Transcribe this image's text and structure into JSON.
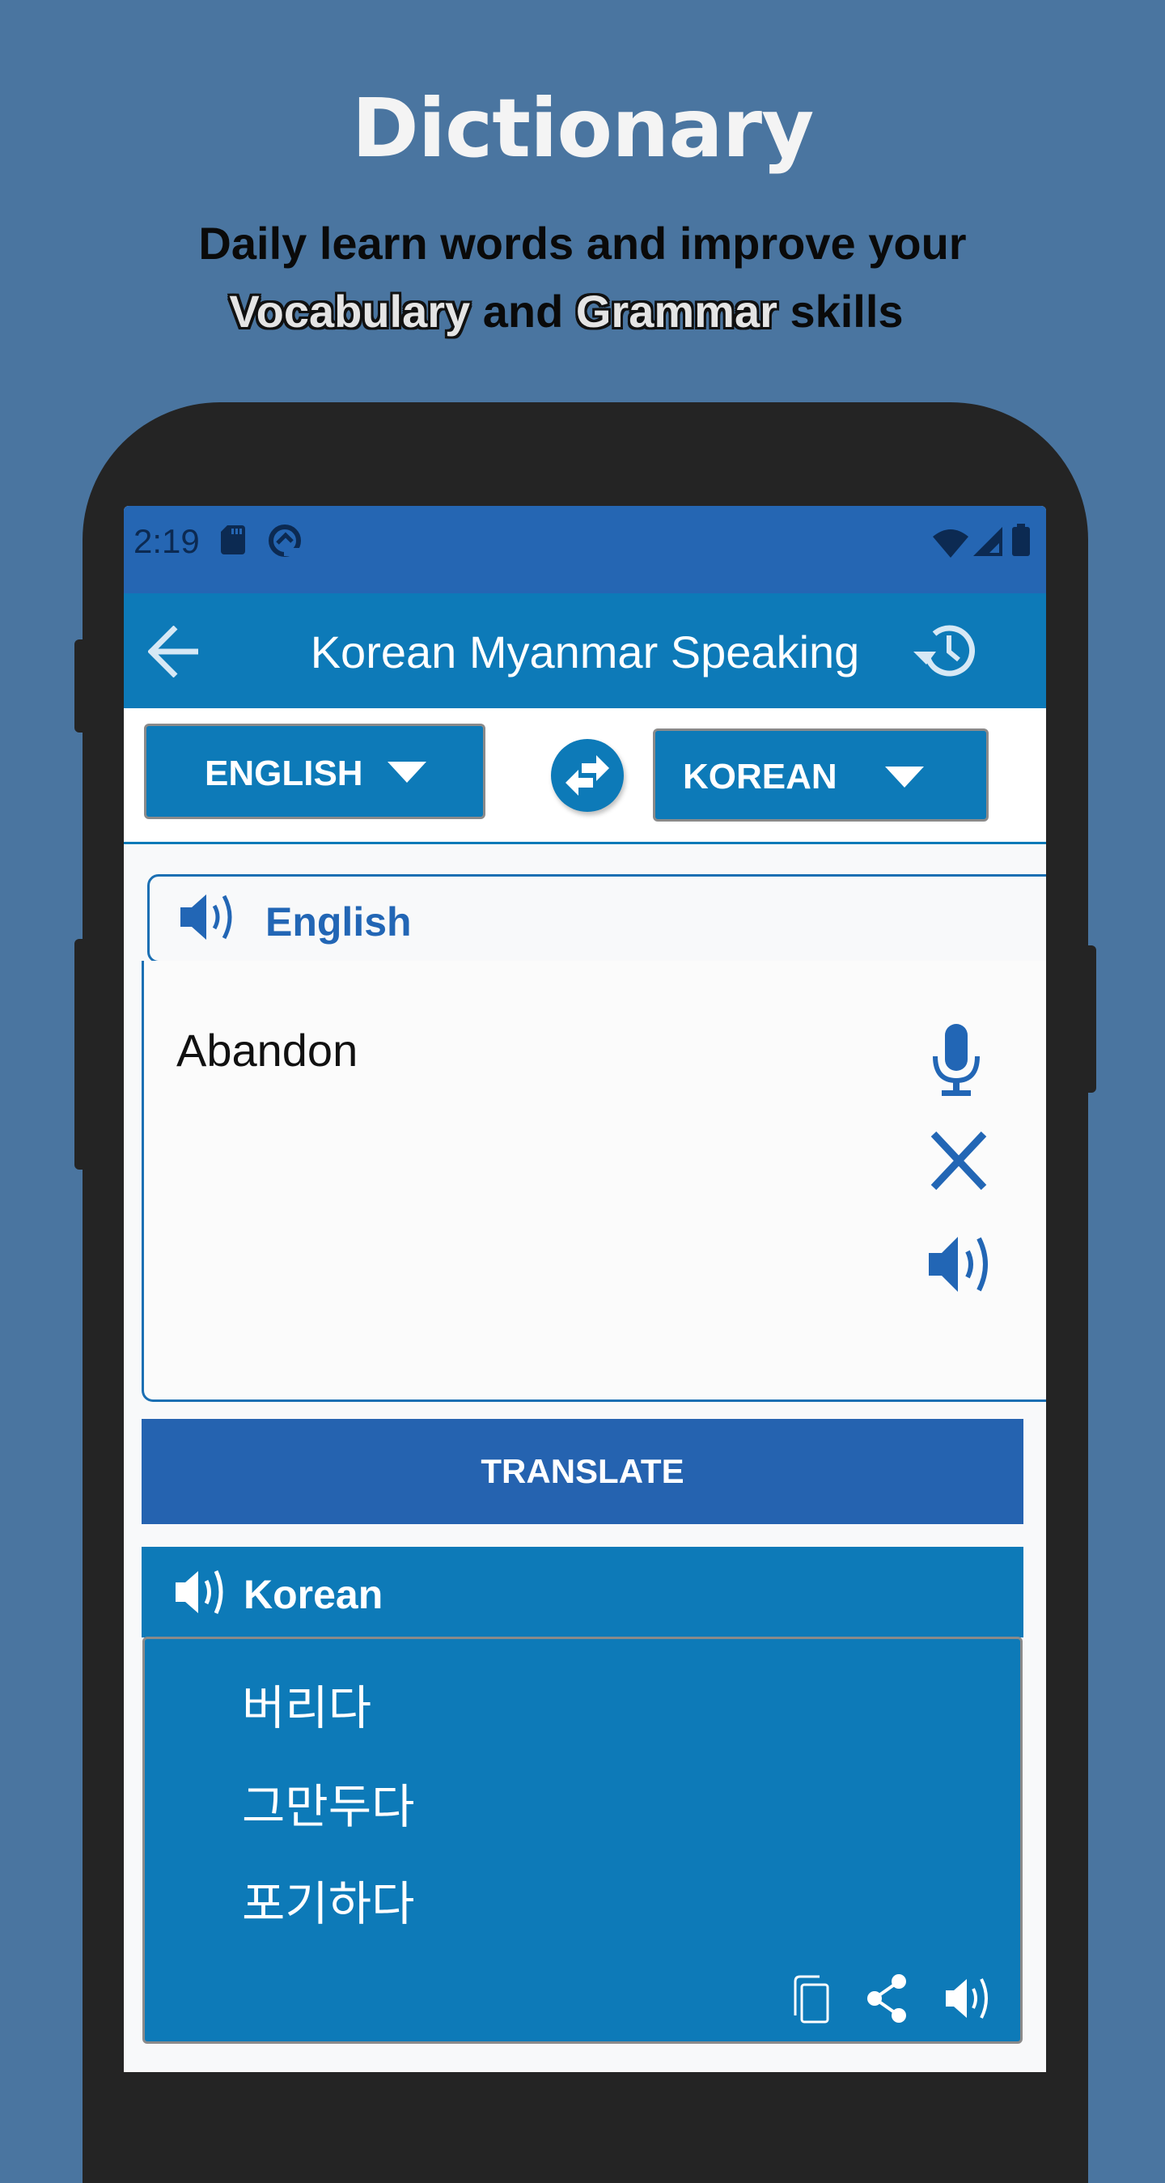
{
  "promo": {
    "title": "Dictionary",
    "line1": "Daily learn words and improve your",
    "line2_word1": "Vocabulary",
    "line2_and": " and ",
    "line2_word2": "Grammar",
    "line2_end": " skills"
  },
  "status_bar": {
    "time": "2:19",
    "icons_left": [
      "sd-card-icon",
      "sync-icon"
    ],
    "icons_right": [
      "wifi-icon",
      "signal-icon",
      "battery-icon"
    ]
  },
  "toolbar": {
    "back_icon": "arrow-left-icon",
    "title": "Korean Myanmar Speaking",
    "history_icon": "history-icon"
  },
  "languages": {
    "source": "ENGLISH",
    "target": "KOREAN",
    "swap_icon": "swap-arrows-icon"
  },
  "input_panel": {
    "header_label": "English",
    "text": "Abandon",
    "actions": [
      "microphone-icon",
      "clear-icon",
      "speaker-icon"
    ]
  },
  "translate_button": "TRANSLATE",
  "result_panel": {
    "header_label": "Korean",
    "words": [
      "버리다",
      "그만두다",
      "포기하다"
    ],
    "actions": [
      "copy-icon",
      "share-icon",
      "speaker-icon"
    ]
  },
  "colors": {
    "background": "#4a75a0",
    "status_bar": "#2566b3",
    "primary": "#0d7ab8",
    "button": "#2563b0",
    "accent_text": "#2266b5"
  }
}
